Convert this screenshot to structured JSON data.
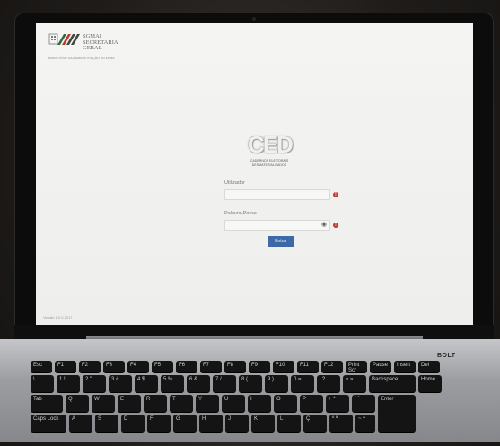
{
  "logo": {
    "line1": "SGMAI",
    "line2": "SECRETARIA",
    "line3": "GERAL",
    "subtitle": "MINISTÉRIO DA ADMINISTRAÇÃO INTERNA"
  },
  "ced": {
    "mark": "CED",
    "line1": "CADERNOS ELEITORAIS",
    "line2": "DESMATERIALIZADOS"
  },
  "form": {
    "username_label": "Utilizador",
    "password_label": "Palavra-Passe",
    "submit_label": "Entrar"
  },
  "footer": {
    "version": "Versão 1.0.0.2017"
  },
  "laptop": {
    "brand": "BOLT"
  },
  "keyboard": {
    "row1": [
      "Esc",
      "F1",
      "F2",
      "F3",
      "F4",
      "F5",
      "F6",
      "F7",
      "F8",
      "F9",
      "F10",
      "F11",
      "F12",
      "Print Scr",
      "Pause",
      "Insert",
      "Del"
    ],
    "row2": [
      "\\",
      "1 !",
      "2 \"",
      "3 #",
      "4 $",
      "5 %",
      "6 &",
      "7 /",
      "8 (",
      "9 )",
      "0 =",
      "' ?",
      "« »",
      "Backspace",
      "Home"
    ],
    "row3": [
      "Tab",
      "Q",
      "W",
      "E",
      "R",
      "T",
      "Y",
      "U",
      "I",
      "O",
      "P",
      "+ *",
      "´ `",
      "Enter"
    ],
    "row4": [
      "Caps Lock",
      "A",
      "S",
      "D",
      "F",
      "G",
      "H",
      "J",
      "K",
      "L",
      "Ç",
      "º ª",
      "~ ^"
    ]
  },
  "colors": {
    "button": "#3d6aa6",
    "error": "#c0392b",
    "screen": "#f2f2f0"
  }
}
